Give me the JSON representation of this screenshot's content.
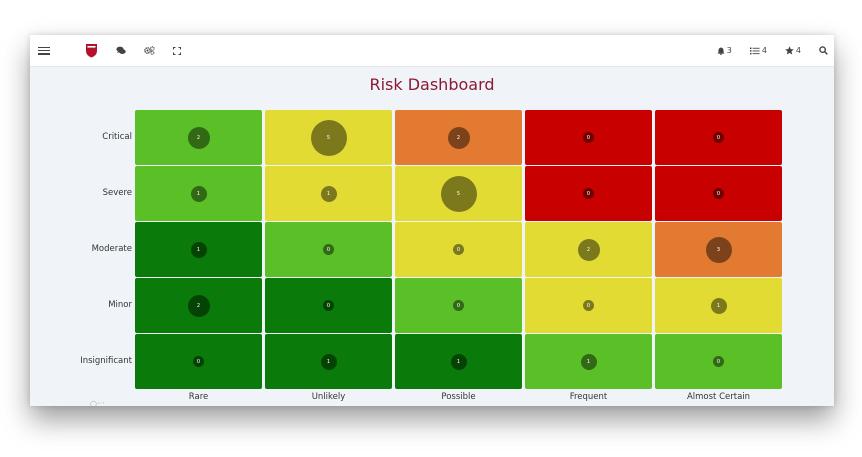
{
  "dashboard": {
    "title": "Risk Dashboard"
  },
  "topbar": {
    "icons_left": [
      "menu-icon",
      "logo",
      "chat-icon",
      "cogs-icon",
      "fullscreen-icon"
    ],
    "alerts_count": "3",
    "tasks_count": "4",
    "favorites_count": "4"
  },
  "matrix": {
    "rows": [
      "Critical",
      "Severe",
      "Moderate",
      "Minor",
      "Insignificant"
    ],
    "columns": [
      "Rare",
      "Unlikely",
      "Possible",
      "Frequent",
      "Almost Certain"
    ],
    "colors": {
      "light_green": "#5bbf27",
      "dark_green": "#0a7a0a",
      "yellow": "#e2db34",
      "orange": "#e27a31",
      "red": "#c90000"
    },
    "cells": [
      [
        {
          "count": "2",
          "level": "light_green"
        },
        {
          "count": "5",
          "level": "yellow"
        },
        {
          "count": "2",
          "level": "orange"
        },
        {
          "count": "0",
          "level": "red"
        },
        {
          "count": "0",
          "level": "red"
        }
      ],
      [
        {
          "count": "1",
          "level": "light_green"
        },
        {
          "count": "1",
          "level": "yellow"
        },
        {
          "count": "5",
          "level": "yellow"
        },
        {
          "count": "0",
          "level": "red"
        },
        {
          "count": "0",
          "level": "red"
        }
      ],
      [
        {
          "count": "1",
          "level": "dark_green"
        },
        {
          "count": "0",
          "level": "light_green"
        },
        {
          "count": "0",
          "level": "yellow"
        },
        {
          "count": "2",
          "level": "yellow"
        },
        {
          "count": "3",
          "level": "orange"
        }
      ],
      [
        {
          "count": "2",
          "level": "dark_green"
        },
        {
          "count": "0",
          "level": "dark_green"
        },
        {
          "count": "0",
          "level": "light_green"
        },
        {
          "count": "0",
          "level": "yellow"
        },
        {
          "count": "1",
          "level": "yellow"
        }
      ],
      [
        {
          "count": "0",
          "level": "dark_green"
        },
        {
          "count": "1",
          "level": "dark_green"
        },
        {
          "count": "1",
          "level": "dark_green"
        },
        {
          "count": "1",
          "level": "light_green"
        },
        {
          "count": "0",
          "level": "light_green"
        }
      ]
    ]
  }
}
